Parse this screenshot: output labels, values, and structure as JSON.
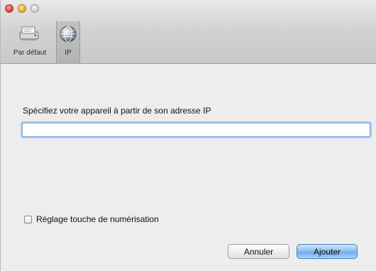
{
  "window": {
    "controls": [
      "close",
      "minimize",
      "zoom"
    ]
  },
  "toolbar": {
    "items": [
      {
        "label": "Par défaut",
        "icon": "scanner-printer-icon",
        "selected": false
      },
      {
        "label": "IP",
        "icon": "network-globe-icon",
        "selected": true
      }
    ]
  },
  "form": {
    "prompt": "Spécifiez votre appareil à partir de son adresse IP",
    "ip_value": "",
    "ip_placeholder": "",
    "checkbox_label": "Réglage touche de numérisation",
    "checkbox_checked": false
  },
  "buttons": {
    "cancel": "Annuler",
    "add": "Ajouter"
  },
  "colors": {
    "accent": "#73aaeb",
    "focus_ring": "#a9c9ee"
  }
}
